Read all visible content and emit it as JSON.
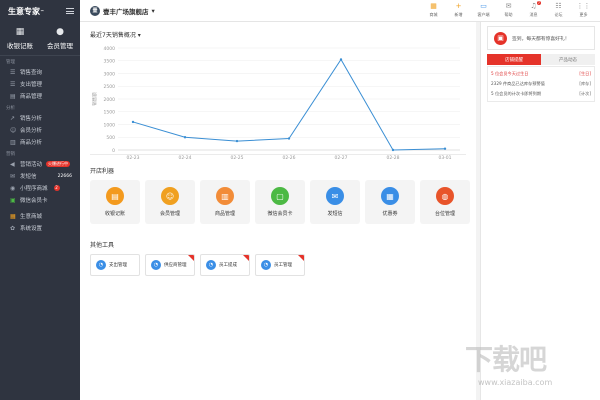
{
  "brand": {
    "name": "生意专家",
    "tm": "™"
  },
  "quick": [
    {
      "label": "收银记账",
      "icon": "cashier-icon"
    },
    {
      "label": "会员管理",
      "icon": "person-icon"
    }
  ],
  "sidebar": {
    "sections": [
      {
        "title": "管理",
        "items": [
          {
            "label": "销售查询",
            "icon": "list-icon"
          },
          {
            "label": "支出管理",
            "icon": "expense-icon"
          },
          {
            "label": "商品管理",
            "icon": "goods-icon"
          }
        ]
      },
      {
        "title": "分析",
        "items": [
          {
            "label": "销售分析",
            "icon": "trend-icon"
          },
          {
            "label": "会员分析",
            "icon": "member-icon"
          },
          {
            "label": "商品分析",
            "icon": "bars-icon"
          }
        ]
      },
      {
        "title": "营销",
        "items": [
          {
            "label": "营销活动",
            "icon": "megaphone-icon",
            "badge": "火爆进行中"
          },
          {
            "label": "发短信",
            "icon": "sms-icon",
            "num": "22666"
          },
          {
            "label": "小程序商城",
            "icon": "miniapp-icon",
            "dot": "2"
          },
          {
            "label": "微信会员卡",
            "icon": "wechat-card-icon"
          }
        ]
      }
    ],
    "extra": [
      {
        "label": "生意商城",
        "icon": "shop-grid-icon"
      },
      {
        "label": "系统设置",
        "icon": "gear-icon"
      }
    ]
  },
  "topbar": {
    "store_logo": "壹",
    "store_name": "壹丰广场旗舰店",
    "tools": [
      {
        "label": "商城",
        "icon": "store-icon",
        "glyph": "▦",
        "color": "orange"
      },
      {
        "label": "新增",
        "icon": "plus-icon",
        "glyph": "+",
        "color": "orange"
      },
      {
        "label": "客户端",
        "icon": "monitor-icon",
        "glyph": "▭",
        "color": "blue"
      },
      {
        "label": "帮助",
        "icon": "help-icon",
        "glyph": "✉",
        "color": ""
      },
      {
        "label": "消息",
        "icon": "bell-icon",
        "glyph": "♫",
        "color": "",
        "badge": "7"
      },
      {
        "label": "论坛",
        "icon": "forum-icon",
        "glyph": "☷",
        "color": ""
      },
      {
        "label": "更多",
        "icon": "more-icon",
        "glyph": "⋮⋮",
        "color": ""
      }
    ]
  },
  "main": {
    "chart_title": "最近7天销售概况",
    "open_tools_title": "开店利器",
    "apps": [
      {
        "label": "收银记账",
        "color": "#f39a1e",
        "glyph": "▤"
      },
      {
        "label": "会员管理",
        "color": "#f0a020",
        "glyph": "☺"
      },
      {
        "label": "商品管理",
        "color": "#f28c38",
        "glyph": "▥"
      },
      {
        "label": "微信会员卡",
        "color": "#4cb944",
        "glyph": "▢"
      },
      {
        "label": "发短信",
        "color": "#3a8ee6",
        "glyph": "✉"
      },
      {
        "label": "优惠券",
        "color": "#3a8ee6",
        "glyph": "▦"
      },
      {
        "label": "台位管理",
        "color": "#e8542a",
        "glyph": "◍"
      }
    ],
    "other_tools_title": "其他工具",
    "other_tools": [
      {
        "label": "支出管理",
        "corner": false
      },
      {
        "label": "供应商管理",
        "corner": true
      },
      {
        "label": "员工提成",
        "corner": true
      },
      {
        "label": "员工管理",
        "corner": true
      }
    ]
  },
  "right": {
    "signin_text": "签到，每天都有惊喜好礼！",
    "tabs": [
      "店铺提醒",
      "产品动态"
    ],
    "notices": [
      {
        "text": "5 位会员今天过生日",
        "tag": "[生日]",
        "highlight": true
      },
      {
        "text": "2329 件商品已达库存预警值",
        "tag": "[库存]",
        "highlight": false
      },
      {
        "text": "5 位会员的计次卡即将到期",
        "tag": "[计次]",
        "highlight": false
      }
    ]
  },
  "watermark": {
    "big": "下载吧",
    "small": "www.xiazaiba.com"
  },
  "chart_data": {
    "type": "line",
    "title": "最近7天销售概况",
    "categories": [
      "02-23",
      "02-24",
      "02-25",
      "02-26",
      "02-27",
      "02-28",
      "03-01"
    ],
    "series": [
      {
        "values": [
          1100,
          500,
          350,
          450,
          3550,
          0,
          50
        ]
      }
    ],
    "ylabel": "销售额",
    "ylim": [
      0,
      4000
    ],
    "yticks": [
      0,
      500,
      1000,
      1500,
      2000,
      2500,
      3000,
      3500,
      4000
    ],
    "grid": true,
    "line_color": "#3b8fd4"
  }
}
